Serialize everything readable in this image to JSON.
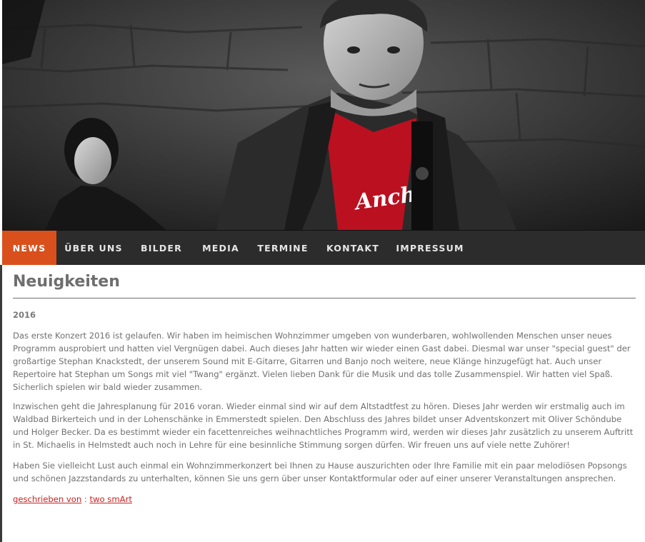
{
  "nav": {
    "items": [
      {
        "label": "NEWS",
        "active": true
      },
      {
        "label": "ÜBER UNS",
        "active": false
      },
      {
        "label": "BILDER",
        "active": false
      },
      {
        "label": "MEDIA",
        "active": false
      },
      {
        "label": "TERMINE",
        "active": false
      },
      {
        "label": "KONTAKT",
        "active": false
      },
      {
        "label": "IMPRESSUM",
        "active": false
      }
    ],
    "active_color": "#d9501d",
    "bg_color": "#2c2c2c"
  },
  "hero": {
    "shirt_text": "Anch"
  },
  "article": {
    "title": "Neuigkeiten",
    "year": "2016",
    "paragraphs": [
      "Das erste Konzert 2016 ist gelaufen. Wir haben im heimischen Wohnzimmer umgeben von wunderbaren, wohlwollenden Menschen unser neues Programm ausprobiert und hatten viel Vergnügen dabei. Auch dieses Jahr hatten wir wieder einen Gast dabei. Diesmal war unser \"special guest\" der großartige Stephan Knackstedt, der unserem Sound mit E-Gitarre, Gitarren und Banjo noch weitere, neue Klänge hinzugefügt hat. Auch unser Repertoire hat Stephan um Songs mit viel \"Twang\" ergänzt. Vielen lieben Dank für die Musik und das tolle Zusammenspiel. Wir hatten viel Spaß. Sicherlich spielen wir bald wieder zusammen.",
      "Inzwischen geht die Jahresplanung für 2016 voran. Wieder einmal sind wir auf dem Altstadtfest zu hören. Dieses Jahr werden wir erstmalig auch im Waldbad Birkerteich und in der Lohenschänke in Emmerstedt spielen. Den Abschluss des Jahres bildet unser Adventskonzert mit Oliver Schöndube und Holger Becker. Da es bestimmt wieder ein facettenreiches weihnachtliches Programm wird, werden wir dieses Jahr zusätzlich zu unserem Auftritt in St. Michaelis in Helmstedt auch noch in Lehre für eine besinnliche Stimmung sorgen dürfen. Wir freuen uns auf viele nette Zuhörer!",
      "Haben Sie vielleicht Lust auch einmal ein Wohnzimmerkonzert bei Ihnen zu Hause auszurichten oder Ihre Familie mit ein paar melodiösen Popsongs und schönen Jazzstandards zu unterhalten, können Sie uns gern über unser Kontaktformular oder auf einer unserer Veranstaltungen ansprechen."
    ],
    "written_by_label": "geschrieben von",
    "separator": ":",
    "author": "two smArt"
  }
}
